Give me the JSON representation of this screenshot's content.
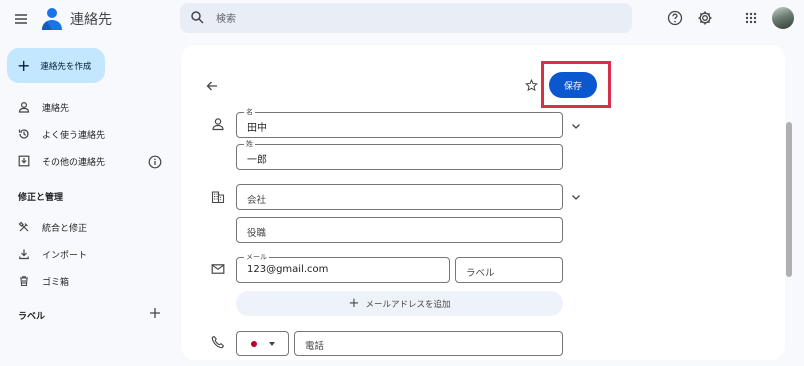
{
  "app": {
    "title": "連絡先"
  },
  "search": {
    "placeholder": "検索"
  },
  "sidebar": {
    "create_label": "連絡先を作成",
    "items": [
      {
        "label": "連絡先"
      },
      {
        "label": "よく使う連絡先"
      },
      {
        "label": "その他の連絡先"
      }
    ],
    "section_manage": "修正と管理",
    "manage_items": [
      {
        "label": "統合と修正"
      },
      {
        "label": "インポート"
      },
      {
        "label": "ゴミ箱"
      }
    ],
    "section_labels": "ラベル"
  },
  "form": {
    "save_label": "保存",
    "first_name": {
      "label": "名",
      "value": "田中"
    },
    "last_name": {
      "label": "姓",
      "value": "一郎"
    },
    "company_placeholder": "会社",
    "title_placeholder": "役職",
    "email": {
      "label": "メール",
      "value": "123@gmail.com"
    },
    "email_type_placeholder": "ラベル",
    "add_email_label": "メールアドレスを追加",
    "phone_placeholder": "電話"
  },
  "colors": {
    "accent": "#0b57d0",
    "create_bg": "#c2e7ff",
    "highlight": "#d8304b"
  }
}
